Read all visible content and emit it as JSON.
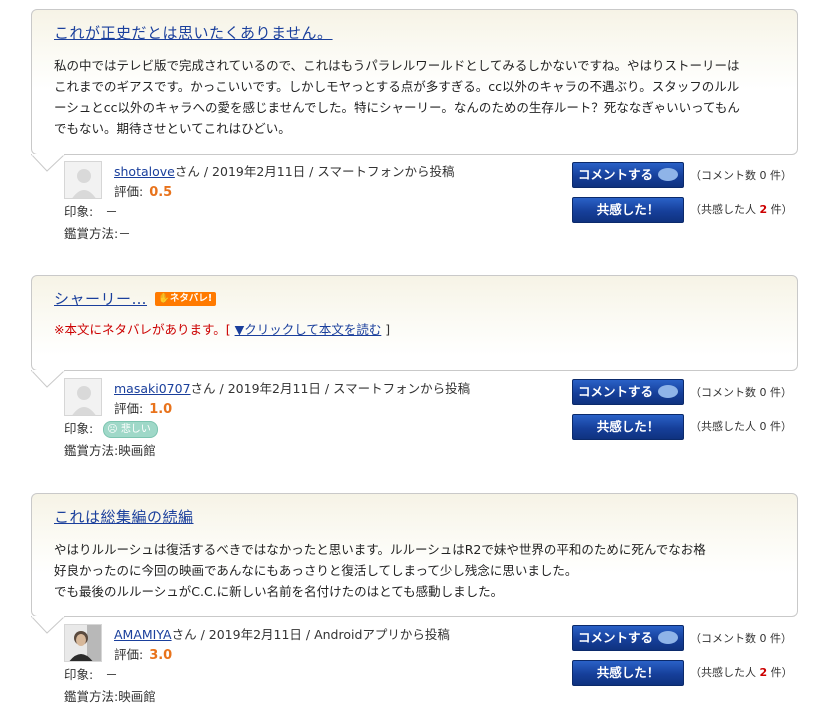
{
  "reviews": [
    {
      "title": "これが正史だとは思いたくありません。",
      "spoiler_tag": "",
      "body_lines": [
        "私の中ではテレビ版で完成されているので、これはもうパラレルワールドとしてみるしかないですね。やはりストーリーは",
        "これまでのギアスです。かっこいいです。しかしモヤっとする点が多すぎる。cc以外のキャラの不遇ぶり。スタッフのルル",
        "ーシュとcc以外のキャラへの愛を感じませんでした。特にシャーリー。なんのための生存ルート？死ななぎゃいいってもん",
        "でもない。期待させといてこれはひどい。"
      ],
      "user": "shotalove",
      "user_suffix": "さん",
      "meta_rest": " / 2019年2月11日 / スマートフォンから投稿",
      "rating_label": "評価:",
      "rating": "0.5",
      "impression_label": "印象:",
      "impression_value": "－",
      "method_label": "鑑賞方法:",
      "method_value": "－",
      "comment_button": "コメントする",
      "comment_note": "（コメント数 0 件）",
      "agree_button": "共感した！",
      "agree_note_pre": "（共感した人 ",
      "agree_count": "2",
      "agree_note_post": " 件）"
    },
    {
      "title": "シャーリー…",
      "spoiler_tag": "ネタバレ!",
      "spoiler_warning_pre": "※本文にネタバレがあります。[ ",
      "spoiler_link": "▼クリックして本文を読む",
      "spoiler_warning_post": " ]",
      "user": "masaki0707",
      "user_suffix": "さん",
      "meta_rest": " / 2019年2月11日 / スマートフォンから投稿",
      "rating_label": "評価:",
      "rating": "1.0",
      "impression_label": "印象:",
      "impression_badge": "悲しい",
      "method_label": "鑑賞方法:",
      "method_value": "映画館",
      "comment_button": "コメントする",
      "comment_note": "（コメント数 0 件）",
      "agree_button": "共感した！",
      "agree_note_pre": "（共感した人 ",
      "agree_count": "0",
      "agree_note_post": " 件）"
    },
    {
      "title": "これは総集編の続編",
      "spoiler_tag": "",
      "body_lines": [
        "やはりルルーシュは復活するべきではなかったと思います。ルルーシュはR2で妹や世界の平和のために死んでなお格",
        "好良かったのに今回の映画であんなにもあっさりと復活してしまって少し残念に思いました。",
        "でも最後のルルーシュがC.C.に新しい名前を名付けたのはとても感動しました。"
      ],
      "user": "AMAMIYA",
      "user_suffix": "さん",
      "meta_rest": " / 2019年2月11日 / Androidアプリから投稿",
      "rating_label": "評価:",
      "rating": "3.0",
      "impression_label": "印象:",
      "impression_value": "－",
      "method_label": "鑑賞方法:",
      "method_value": "映画館",
      "comment_button": "コメントする",
      "comment_note": "（コメント数 0 件）",
      "agree_button": "共感した！",
      "agree_note_pre": "（共感した人 ",
      "agree_count": "2",
      "agree_note_post": " 件）"
    }
  ],
  "colors": {
    "link": "#1a3f9c",
    "rating": "#e8731c",
    "button": "#163f9a",
    "spoiler": "#ff7a00",
    "warning": "#cc0000"
  },
  "icons": [
    "default-avatar-icon",
    "speech-bubble-icon",
    "sad-face-icon",
    "hand-icon"
  ]
}
